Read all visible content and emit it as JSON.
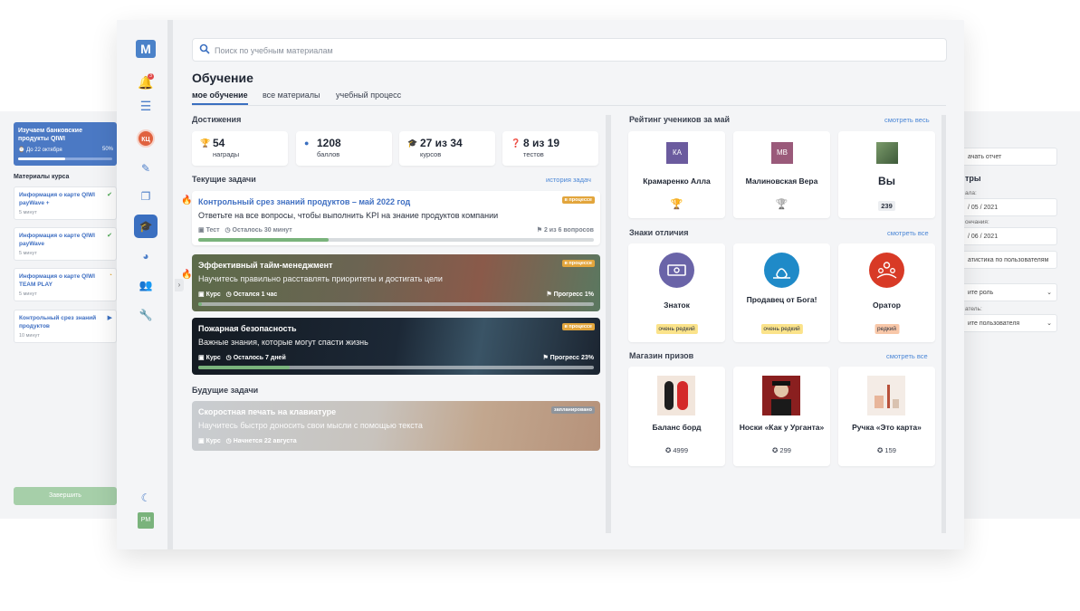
{
  "colors": {
    "accent": "#3a6fc0",
    "danger": "#e04a2c",
    "tag_yellow": "#fbe38a",
    "tag_orange": "#f8c7a8"
  },
  "ghost_left": {
    "course_card": {
      "title": "Изучаем банковские продукты QIWI",
      "date": "До 22 октября",
      "progress_text": "50%",
      "progress": 0.5
    },
    "materials_header": "Материалы курса",
    "items": [
      {
        "title": "Информация о карте QIWI payWave +",
        "meta": "5 минут",
        "icon": "check-icon"
      },
      {
        "title": "Информация о карте QIWI payWave",
        "meta": "5 минут",
        "icon": "check-icon"
      },
      {
        "title": "Информация о карте QIWI TEAM PLAY",
        "meta": "5 минут",
        "icon": "pie-icon"
      },
      {
        "title": "Контрольный срез знаний продуктов",
        "meta": "10 минут",
        "icon": "play-icon"
      }
    ],
    "finish_button": "Завершить"
  },
  "ghost_right": {
    "report_button": "ачать отчет",
    "filters_header": "тры",
    "start_label": "ала:",
    "start_value": "/ 05 / 2021",
    "end_label": "ончания:",
    "end_value": "/ 06 / 2021",
    "stat_option": "атистика по пользователям",
    "role_label": "",
    "role_value": "ите роль",
    "user_label": "атель:",
    "user_value": "ите пользователя"
  },
  "rail": {
    "logo": "M",
    "bell_count": "3",
    "user_initials": "КЦ",
    "bottom_initials": "PM"
  },
  "search": {
    "placeholder": "Поиск по учебным материалам"
  },
  "page": {
    "title": "Обучение",
    "tabs": [
      "мое обучение",
      "все материалы",
      "учебный процесс"
    ]
  },
  "achievements": {
    "header": "Достижения",
    "items": [
      {
        "value": "54",
        "label": "награды",
        "icon": "trophy-icon"
      },
      {
        "value": "1208",
        "label": "баллов",
        "icon": "coin-icon"
      },
      {
        "value": "27 из 34",
        "label": "курсов",
        "icon": "graduation-cap-icon"
      },
      {
        "value": "8 из 19",
        "label": "тестов",
        "icon": "quiz-icon"
      }
    ]
  },
  "current_tasks": {
    "header": "Текущие задачи",
    "history_link": "история задач",
    "items": [
      {
        "title": "Контрольный срез знаний продуктов – май 2022 год",
        "desc": "Ответьте на все вопросы, чтобы выполнить KPI на знание продуктов компании",
        "type": "Тест",
        "time": "Осталось 30 минут",
        "right": "2 из 6 вопросов",
        "status": "в процессе",
        "progress": 0.33
      },
      {
        "title": "Эффективный тайм-менеджмент",
        "desc": "Научитесь правильно расставлять приоритеты и достигать цели",
        "type": "Курс",
        "time": "Остался 1 час",
        "right": "Прогресс 1%",
        "status": "в процессе",
        "progress": 0.01
      },
      {
        "title": "Пожарная безопасность",
        "desc": "Важные знания, которые могут спасти жизнь",
        "type": "Курс",
        "time": "Осталось 7 дней",
        "right": "Прогресс 23%",
        "status": "в процессе",
        "progress": 0.23
      }
    ]
  },
  "future_tasks": {
    "header": "Будущие задачи",
    "items": [
      {
        "title": "Скоростная печать на клавиатуре",
        "desc": "Научитесь быстро доносить свои мысли с помощью текста",
        "type": "Курс",
        "time": "Начнется 22 августа",
        "status": "запланировано"
      }
    ]
  },
  "rating": {
    "header": "Рейтинг учеников за май",
    "link": "смотреть весь",
    "items": [
      {
        "initials": "КА",
        "name": "Крамаренко Алла",
        "color": "#6b5b9e",
        "trophy": "gold-trophy-icon"
      },
      {
        "initials": "МВ",
        "name": "Малиновская Вера",
        "color": "#9a5a7a",
        "trophy": "silver-trophy-icon"
      },
      {
        "initials": "",
        "name": "Вы",
        "color": "#6b8f5a",
        "score": "239"
      }
    ]
  },
  "badges": {
    "header": "Знаки отличия",
    "link": "смотреть все",
    "items": [
      {
        "name": "Знаток",
        "tag": "очень редкий",
        "color": "#6a64a8",
        "tag_color": "#fbe38a",
        "icon": "money-icon"
      },
      {
        "name": "Продавец от Бога!",
        "tag": "очень редкий",
        "color": "#1f8ac8",
        "tag_color": "#fbe38a",
        "icon": "money-bag-icon"
      },
      {
        "name": "Оратор",
        "tag": "редкий",
        "color": "#d83a26",
        "tag_color": "#f8c7a8",
        "icon": "audience-icon"
      }
    ]
  },
  "shop": {
    "header": "Магазин призов",
    "link": "смотреть все",
    "items": [
      {
        "name": "Баланс борд",
        "price": "4999",
        "icon": "balance-board-image"
      },
      {
        "name": "Носки «Как у Урганта»",
        "price": "299",
        "icon": "socks-image"
      },
      {
        "name": "Ручка «Это карта»",
        "price": "159",
        "icon": "pen-image"
      }
    ]
  }
}
